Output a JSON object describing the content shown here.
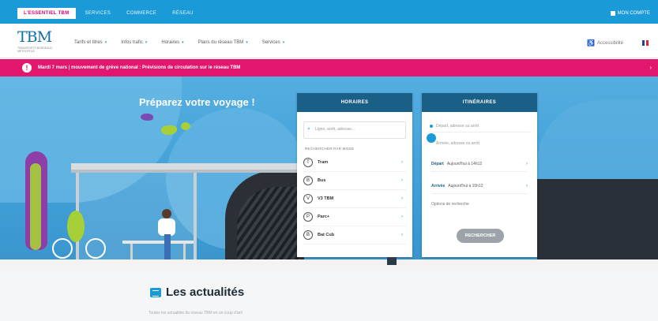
{
  "topbar": {
    "tabs": [
      {
        "label": "L'ESSENTIEL TBM",
        "active": true
      },
      {
        "label": "SERVICES",
        "active": false
      },
      {
        "label": "COMMERCE",
        "active": false
      },
      {
        "label": "RÉSEAU",
        "active": false
      }
    ],
    "login_label": "MON COMPTE"
  },
  "header": {
    "logo_main": "TBM",
    "logo_sub": "TRANSPORTS BORDEAUX MÉTROPOLE",
    "nav": [
      {
        "label": "Tarifs et titres"
      },
      {
        "label": "Infos trafic"
      },
      {
        "label": "Horaires"
      },
      {
        "label": "Plans du réseau TBM"
      },
      {
        "label": "Services"
      }
    ],
    "access_label": "Accessibilité",
    "language": "FR"
  },
  "alert": {
    "text": "Mardi 7 mars | mouvement de grève national : Prévisions de circulation sur le réseau TBM"
  },
  "hero": {
    "title": "Préparez votre voyage !"
  },
  "horaires": {
    "header": "HORAIRES",
    "search_placeholder": "Ligne, arrêt, adresse...",
    "section_label": "RECHERCHER PAR MODE",
    "modes": [
      {
        "icon": "T",
        "label": "Tram"
      },
      {
        "icon": "B",
        "label": "Bus"
      },
      {
        "icon": "V",
        "label": "V3 TBM"
      },
      {
        "icon": "P",
        "label": "Parc+"
      },
      {
        "icon": "B",
        "label": "Bat Cub"
      }
    ]
  },
  "itineraires": {
    "header": "ITINÉRAIRES",
    "departure_placeholder": "Départ, adresse ou arrêt",
    "arrival_placeholder": "Arrivée, adresse ou arrêt",
    "depart_label": "Départ",
    "depart_value": "Aujourd'hui à 14h12",
    "arrivee_label": "Arrivée",
    "arrivee_value": "Aujourd'hui à 15h12",
    "options_label": "Options de recherche",
    "submit_label": "Rechercher"
  },
  "news": {
    "title": "Les actualités",
    "subtitle": "Toutes les actualités du réseau TBM en un coup d'œil"
  }
}
